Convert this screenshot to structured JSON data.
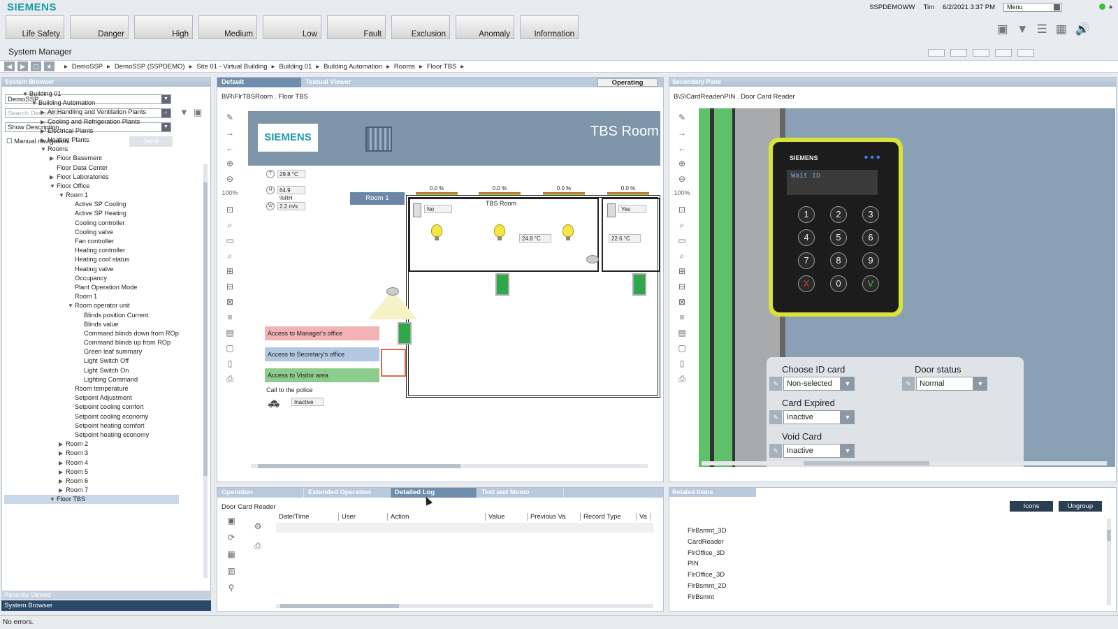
{
  "brand": "SIEMENS",
  "topbar": {
    "user_host": "SSPDEMOWW",
    "user": "Tim",
    "datetime": "6/2/2021 3:37 PM",
    "menu": "Menu"
  },
  "alarm_buttons": [
    "Life Safety",
    "Danger",
    "High",
    "Medium",
    "Low",
    "Fault",
    "Exclusion",
    "Anomaly",
    "Information"
  ],
  "app_title": "System Manager",
  "breadcrumb": [
    "DemoSSP",
    "DemoSSP (SSPDEMO)",
    "Site 01 - Virtual Building",
    "Building 01",
    "Building Automation",
    "Rooms",
    "Floor TBS"
  ],
  "system_browser": {
    "header": "System Browser",
    "view_select": "DemoSSP",
    "search_placeholder": "Search DemoSSP",
    "display_select": "Show Description",
    "manual_nav": "Manual navigation",
    "send_btn": "Send",
    "tree": [
      {
        "d": 2,
        "t": "▼",
        "l": "Building 01"
      },
      {
        "d": 3,
        "t": "▼",
        "l": "Building Automation"
      },
      {
        "d": 4,
        "t": "▶",
        "l": "Air Handling and Ventilation Plants"
      },
      {
        "d": 4,
        "t": "▶",
        "l": "Cooling and Refrigeration Plants"
      },
      {
        "d": 4,
        "t": "▶",
        "l": "Electrical Plants"
      },
      {
        "d": 4,
        "t": "▶",
        "l": "Heating Plants"
      },
      {
        "d": 4,
        "t": "▼",
        "l": "Rooms"
      },
      {
        "d": 5,
        "t": "▶",
        "l": "Floor Basement"
      },
      {
        "d": 5,
        "t": "",
        "l": "Floor Data Center"
      },
      {
        "d": 5,
        "t": "▶",
        "l": "Floor Laboratories"
      },
      {
        "d": 5,
        "t": "▼",
        "l": "Floor Office"
      },
      {
        "d": 6,
        "t": "▼",
        "l": "Room 1"
      },
      {
        "d": 7,
        "t": "",
        "l": "Active SP Cooling"
      },
      {
        "d": 7,
        "t": "",
        "l": "Active SP Heating"
      },
      {
        "d": 7,
        "t": "",
        "l": "Cooling controller"
      },
      {
        "d": 7,
        "t": "",
        "l": "Cooling valve"
      },
      {
        "d": 7,
        "t": "",
        "l": "Fan controller"
      },
      {
        "d": 7,
        "t": "",
        "l": "Heating controller"
      },
      {
        "d": 7,
        "t": "",
        "l": "Heating cool status"
      },
      {
        "d": 7,
        "t": "",
        "l": "Heating valve"
      },
      {
        "d": 7,
        "t": "",
        "l": "Occupancy"
      },
      {
        "d": 7,
        "t": "",
        "l": "Plant Operation Mode"
      },
      {
        "d": 7,
        "t": "",
        "l": "Room 1"
      },
      {
        "d": 7,
        "t": "▼",
        "l": "Room operator unit"
      },
      {
        "d": 8,
        "t": "",
        "l": "Blinds position Current"
      },
      {
        "d": 8,
        "t": "",
        "l": "Blinds value"
      },
      {
        "d": 8,
        "t": "",
        "l": "Command blinds down from ROp"
      },
      {
        "d": 8,
        "t": "",
        "l": "Command blinds up from ROp"
      },
      {
        "d": 8,
        "t": "",
        "l": "Green leaf summary"
      },
      {
        "d": 8,
        "t": "",
        "l": "Light Switch Off"
      },
      {
        "d": 8,
        "t": "",
        "l": "Light Switch On"
      },
      {
        "d": 8,
        "t": "",
        "l": "Lighting Command"
      },
      {
        "d": 7,
        "t": "",
        "l": "Room temperature"
      },
      {
        "d": 7,
        "t": "",
        "l": "Setpoint Adjustment"
      },
      {
        "d": 7,
        "t": "",
        "l": "Setpoint cooling comfort"
      },
      {
        "d": 7,
        "t": "",
        "l": "Setpoint cooling economy"
      },
      {
        "d": 7,
        "t": "",
        "l": "Setpoint heating comfort"
      },
      {
        "d": 7,
        "t": "",
        "l": "Setpoint heating economy"
      },
      {
        "d": 6,
        "t": "▶",
        "l": "Room 2"
      },
      {
        "d": 6,
        "t": "▶",
        "l": "Room 3"
      },
      {
        "d": 6,
        "t": "▶",
        "l": "Room 4"
      },
      {
        "d": 6,
        "t": "▶",
        "l": "Room 5"
      },
      {
        "d": 6,
        "t": "▶",
        "l": "Room 6"
      },
      {
        "d": 6,
        "t": "▶",
        "l": "Room 7"
      },
      {
        "d": 5,
        "t": "▼",
        "l": "Floor TBS",
        "sel": true
      }
    ],
    "recently_viewed": "Recently Viewed",
    "bottom_tab": "System Browser"
  },
  "primary": {
    "tabs": [
      "Default",
      "Textual Viewer"
    ],
    "mode": "Operating",
    "path": "B\\R\\FlrTBSRoom  .  Floor TBS",
    "zoom": "100%",
    "graphic": {
      "logo": "SIEMENS",
      "title": "TBS Room",
      "temp": "29.8 °C",
      "humidity": "64.9 %RH",
      "wind": "2.2 m/s",
      "room_label": "Room 1",
      "pct": [
        "0.0 %",
        "0.0 %",
        "0.0 %",
        "0.0 %"
      ],
      "tbs_room": "TBS Room",
      "no": "No",
      "yes": "Yes",
      "room_temp1": "24.8 °C",
      "room_temp2": "22.6 °C",
      "access_manager": "Access to Manager's office",
      "access_secretary": "Access to Secretary's office",
      "access_visitor": "Access to Visitor area",
      "police_label": "Call to the police",
      "police_value": "Inactive"
    }
  },
  "secondary": {
    "header": "Secondary Pane",
    "path": "B\\S\\CardReader\\PIN  .  Door Card Reader",
    "zoom": "100%",
    "reader": {
      "brand": "SIEMENS",
      "display": "Wait ID",
      "keys": [
        "1",
        "2",
        "3",
        "4",
        "5",
        "6",
        "7",
        "8",
        "9",
        "X",
        "0",
        "V"
      ]
    },
    "controls": {
      "choose_id": "Choose ID card",
      "choose_id_val": "Non-selected",
      "door_status": "Door status",
      "door_status_val": "Normal",
      "card_expired": "Card Expired",
      "card_expired_val": "Inactive",
      "void_card": "Void Card",
      "void_card_val": "Inactive"
    }
  },
  "bottom_left": {
    "tabs": [
      "Operation",
      "Extended Operation",
      "Detailed Log",
      "Text and Memo"
    ],
    "object": "Door Card Reader",
    "columns": [
      "Date/Time",
      "User",
      "Action",
      "Value",
      "Previous Va",
      "Record Type",
      "Va"
    ]
  },
  "bottom_right": {
    "header": "Related Items",
    "icons_btn": "Icons",
    "ungroup_btn": "Ungroup",
    "items": [
      "FlrBsmnt_3D",
      "CardReader",
      "FlrOffice_3D",
      "PIN",
      "FlrOffice_3D",
      "FlrBsmnt_2D",
      "FlrBsmnt"
    ]
  },
  "status": "No errors."
}
